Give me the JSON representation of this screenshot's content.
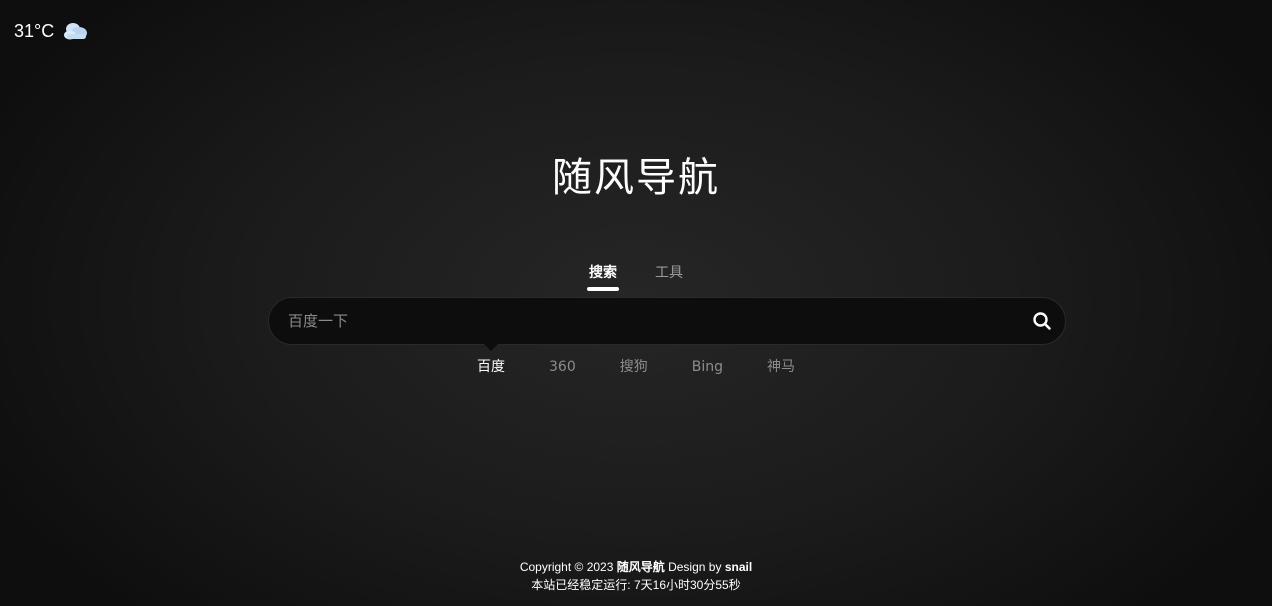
{
  "weather": {
    "temperature": "31°C",
    "icon": "cloud-icon"
  },
  "site": {
    "title": "随风导航"
  },
  "tabs": [
    {
      "label": "搜索",
      "active": true
    },
    {
      "label": "工具",
      "active": false
    }
  ],
  "search": {
    "placeholder": "百度一下",
    "value": ""
  },
  "engines": [
    {
      "label": "百度",
      "active": true
    },
    {
      "label": "360",
      "active": false
    },
    {
      "label": "搜狗",
      "active": false
    },
    {
      "label": "Bing",
      "active": false
    },
    {
      "label": "神马",
      "active": false
    }
  ],
  "footer": {
    "copyright_prefix": "Copyright © 2023",
    "site_name": "随风导航",
    "design_by": "Design by",
    "author": "snail",
    "uptime": "本站已经稳定运行: 7天16小时30分55秒"
  },
  "colors": {
    "background": "#1b1b1b",
    "search_bg": "#0d0d0d",
    "text": "#ffffff",
    "muted": "#8c8c8c"
  }
}
